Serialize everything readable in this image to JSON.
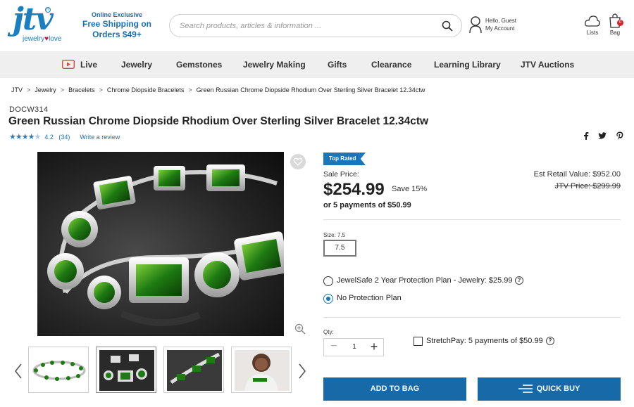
{
  "header": {
    "logo": "jtv",
    "logo_tagline_a": "jewelry",
    "logo_tagline_heart": "♥",
    "logo_tagline_b": "love",
    "promo_line1": "Online Exclusive",
    "promo_line2": "Free Shipping on",
    "promo_line3": "Orders $49+",
    "search_placeholder": "Search products, articles & information ...",
    "account_greeting": "Hello, Guest",
    "account_link": "My Account",
    "lists_label": "Lists",
    "bag_label": "Bag",
    "bag_count": "0"
  },
  "nav": {
    "items": [
      "Live",
      "Jewelry",
      "Gemstones",
      "Jewelry Making",
      "Gifts",
      "Clearance",
      "Learning Library",
      "JTV Auctions"
    ]
  },
  "breadcrumb": [
    "JTV",
    "Jewelry",
    "Bracelets",
    "Chrome Diopside Bracelets",
    "Green Russian Chrome Diopside Rhodium Over Sterling Silver Bracelet 12.34ctw"
  ],
  "product": {
    "sku": "DOCW314",
    "title": "Green Russian Chrome Diopside Rhodium Over Sterling Silver Bracelet 12.34ctw",
    "rating": "4.2",
    "rating_value": 4.2,
    "review_count": "(34)",
    "write_review": "Write a review",
    "badge": "Top Rated",
    "sale_label": "Sale Price:",
    "price": "$254.99",
    "save": "Save 15%",
    "payments": "or 5 payments of $50.99",
    "est_retail": "Est Retail Value: $952.00",
    "jtv_price": "JTV Price: $299.99",
    "size_label": "Size: 7.5",
    "size_value": "7.5",
    "protection_options": [
      {
        "label": "JewelSafe 2 Year Protection Plan - Jewelry: $25.99",
        "selected": false
      },
      {
        "label": "No Protection Plan",
        "selected": true
      }
    ],
    "qty_label": "Qty:",
    "qty_value": "1",
    "stretchpay": "StretchPay: 5 payments of $50.99",
    "add_to_bag": "ADD TO BAG",
    "quick_buy": "QUICK BUY"
  },
  "colors": {
    "brand_blue": "#1a7fc1",
    "button_blue": "#1769a8",
    "nav_bg": "#efefef",
    "live_red": "#e0463a"
  }
}
